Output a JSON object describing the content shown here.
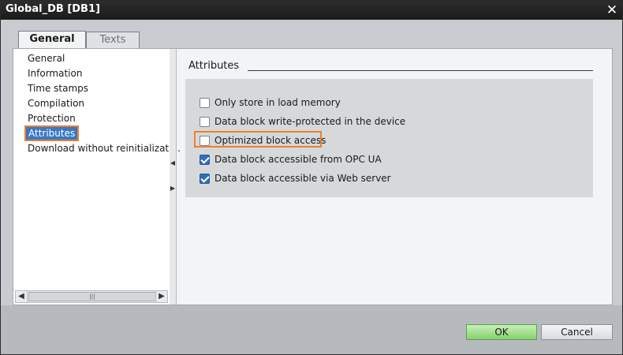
{
  "window": {
    "title": "Global_DB [DB1]"
  },
  "tabs": [
    {
      "label": "General",
      "active": true
    },
    {
      "label": "Texts",
      "active": false
    }
  ],
  "nav": {
    "items": [
      {
        "label": "General"
      },
      {
        "label": "Information"
      },
      {
        "label": "Time stamps"
      },
      {
        "label": "Compilation"
      },
      {
        "label": "Protection"
      },
      {
        "label": "Attributes",
        "selected": true
      },
      {
        "label": "Download without reinitializati..."
      }
    ]
  },
  "section": {
    "title": "Attributes",
    "options": [
      {
        "label": "Only store in load memory",
        "checked": false
      },
      {
        "label": "Data block write-protected in the device",
        "checked": false
      },
      {
        "label": "Optimized block access",
        "checked": false,
        "highlighted": true
      },
      {
        "label": "Data block accessible from OPC UA",
        "checked": true
      },
      {
        "label": "Data block accessible via Web server",
        "checked": true
      }
    ]
  },
  "buttons": {
    "ok": "OK",
    "cancel": "Cancel"
  },
  "colors": {
    "highlight": "#ee7f2d",
    "selection": "#3a78c4",
    "check": "#2f6fb8",
    "ok_button": "#88d070"
  }
}
